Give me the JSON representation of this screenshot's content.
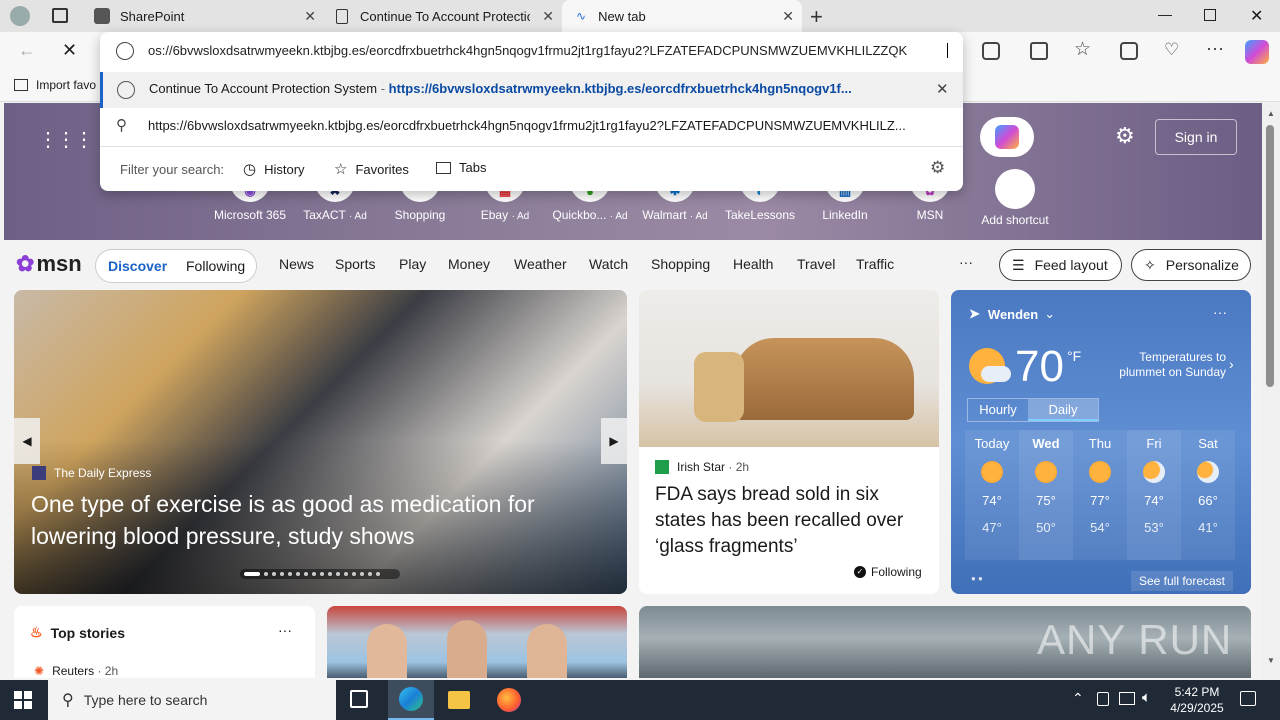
{
  "tabs": [
    {
      "label": "SharePoint"
    },
    {
      "label": "Continue To Account Protection"
    },
    {
      "label": "New tab"
    }
  ],
  "address": {
    "value": "os://6bvwsloxdsatrwmyeekn.ktbjbg.es/eorcdfrxbuetrhck4hgn5nqogv1frmu2jt1rg1fayu2?LFZATEFADCPUNSMWZUEMVKHLILZZQK"
  },
  "suggestions": [
    {
      "title": "Continue To Account Protection System",
      "sep": " - ",
      "url": "https://6bvwsloxdsatrwmyeekn.ktbjbg.es/eorcdfrxbuetrhck4hgn5nqogv1f..."
    },
    {
      "title": "https://6bvwsloxdsatrwmyeekn.ktbjbg.es/eorcdfrxbuetrhck4hgn5nqogv1frmu2jt1rg1fayu2?LFZATEFADCPUNSMWZUEMVKHLILZ..."
    }
  ],
  "filter": {
    "label": "Filter your search:",
    "history": "History",
    "favorites": "Favorites",
    "tabs": "Tabs"
  },
  "favbar": {
    "import": "Import favo"
  },
  "signin": "Sign in",
  "shortcuts": [
    {
      "label": "Microsoft 365",
      "ad": ""
    },
    {
      "label": "TaxACT",
      "ad": "· Ad"
    },
    {
      "label": "Shopping",
      "ad": ""
    },
    {
      "label": "Ebay",
      "ad": "· Ad"
    },
    {
      "label": "Quickbo...",
      "ad": "· Ad"
    },
    {
      "label": "Walmart",
      "ad": "· Ad"
    },
    {
      "label": "TakeLessons",
      "ad": ""
    },
    {
      "label": "LinkedIn",
      "ad": ""
    },
    {
      "label": "MSN",
      "ad": ""
    },
    {
      "label": "Add shortcut",
      "ad": ""
    }
  ],
  "msn": {
    "logo": "msn",
    "discover": "Discover",
    "following": "Following",
    "nav": [
      "News",
      "Sports",
      "Play",
      "Money",
      "Weather",
      "Watch",
      "Shopping",
      "Health",
      "Travel",
      "Traffic"
    ],
    "more": "···",
    "feed_layout": "Feed layout",
    "personalize": "Personalize"
  },
  "hero_story": {
    "source": "The Daily Express",
    "title": "One type of exercise is as good as medication for lowering blood pressure, study shows"
  },
  "bread_story": {
    "source": "Irish Star",
    "time": "· 2h",
    "title": "FDA says bread sold in six states has been recalled over ‘glass fragments’",
    "following": "Following"
  },
  "weather": {
    "location": "Wenden",
    "temp": "70",
    "unit": "°F",
    "alert": "Temperatures to plummet on Sunday",
    "tab_hourly": "Hourly",
    "tab_daily": "Daily",
    "days": [
      {
        "name": "Today",
        "hi": "74°",
        "lo": "47°"
      },
      {
        "name": "Wed",
        "hi": "75°",
        "lo": "50°"
      },
      {
        "name": "Thu",
        "hi": "77°",
        "lo": "54°"
      },
      {
        "name": "Fri",
        "hi": "74°",
        "lo": "53°"
      },
      {
        "name": "Sat",
        "hi": "66°",
        "lo": "41°"
      }
    ],
    "forecast": "See full forecast"
  },
  "top_stories": {
    "title": "Top stories",
    "source": "Reuters",
    "time": "· 2h"
  },
  "taskbar": {
    "search": "Type here to search",
    "time": "5:42 PM",
    "date": "4/29/2025"
  },
  "watermark": "ANY RUN"
}
